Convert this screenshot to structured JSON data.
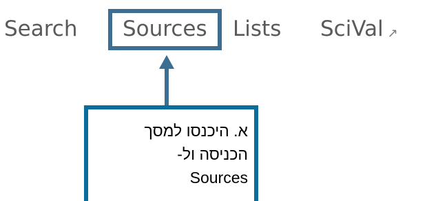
{
  "nav": {
    "items": [
      {
        "label": "Search"
      },
      {
        "label": "Sources"
      },
      {
        "label": "Lists"
      },
      {
        "label": "SciVal",
        "icon": "external-link-icon",
        "icon_glyph": "↗"
      }
    ],
    "highlighted_item": "Sources"
  },
  "callout": {
    "lines": [
      "א. היכנסו למסך",
      "הכניסה ול-",
      "Sources"
    ]
  },
  "colors": {
    "highlight": "#3b6e91",
    "callout_border": "#0b6e9a",
    "nav_text": "#5a5a5a"
  }
}
